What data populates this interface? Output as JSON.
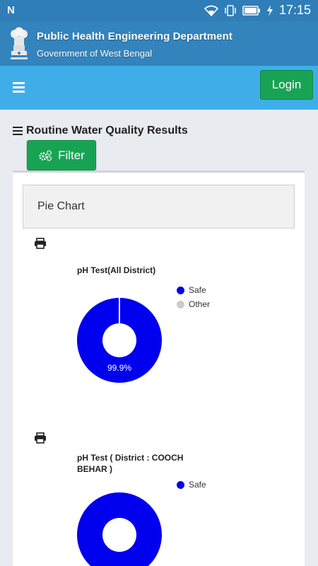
{
  "status_bar": {
    "left_icon": "n-notification-icon",
    "time": "17:15",
    "icons": [
      "wifi-icon",
      "vibrate-icon",
      "battery-icon",
      "charging-icon"
    ]
  },
  "header": {
    "emblem": "state-emblem-icon",
    "title": "Public Health Engineering Department",
    "subtitle": "Government of West Bengal"
  },
  "navbar": {
    "menu_icon": "hamburger-icon",
    "login_label": "Login"
  },
  "page": {
    "title": "Routine Water Quality Results",
    "title_icon": "bars-icon",
    "filter_label": "Filter",
    "filter_icon": "cogs-icon"
  },
  "card": {
    "heading": "Pie Chart",
    "print_icon": "print-icon"
  },
  "colors": {
    "safe": "#0000ee",
    "other": "#cccccc",
    "header_bg": "#3383bd",
    "nav_bg": "#3faee8",
    "button_green": "#18a354"
  },
  "chart_data": [
    {
      "type": "pie",
      "title": "pH Test(All District)",
      "legend": [
        "Safe",
        "Other"
      ],
      "values": [
        99.9,
        0.1
      ],
      "data_label": "99.9%",
      "legend_position": "top-right"
    },
    {
      "type": "pie",
      "title_line1": "pH Test ( District : COOCH",
      "title_line2": "BEHAR )",
      "legend": [
        "Safe"
      ],
      "values": [
        100
      ],
      "legend_position": "top-right"
    }
  ]
}
